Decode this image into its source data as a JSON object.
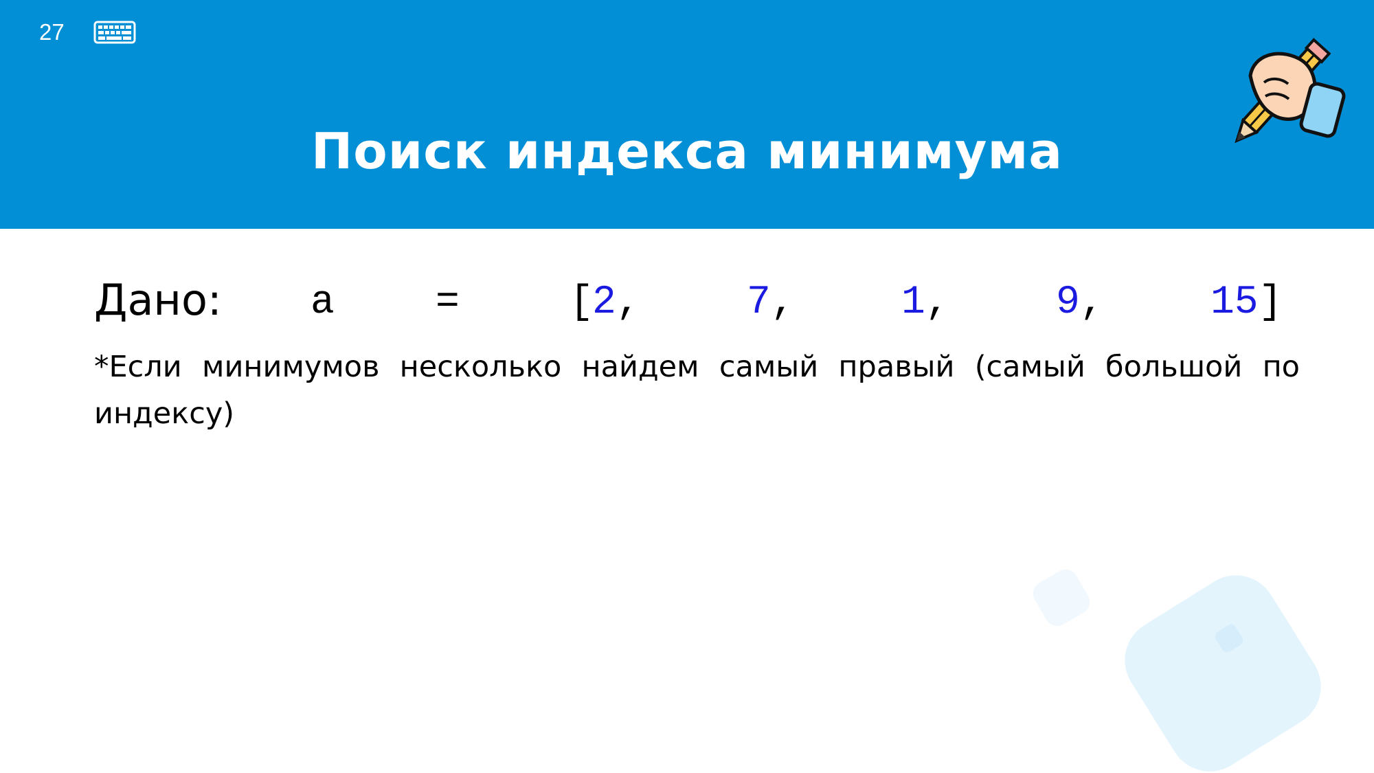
{
  "slide": {
    "number": "27",
    "title": "Поиск индекса минимума"
  },
  "content": {
    "given_label": "Дано:",
    "code": {
      "var": "a",
      "eq": "=",
      "open": "[",
      "items": [
        "2",
        "7",
        "1",
        "9",
        "15"
      ],
      "sep": ",",
      "close": "]"
    },
    "note": "*Если минимумов несколько найдем самый правый (самый большой по индексу)"
  },
  "colors": {
    "header_bg": "#028fd6",
    "number_color": "#1a1ae0",
    "deco_light": "#e3f4fd"
  },
  "icons": {
    "top_left": "keyboard-icon",
    "top_right": "hand-writing-pencil-icon"
  }
}
